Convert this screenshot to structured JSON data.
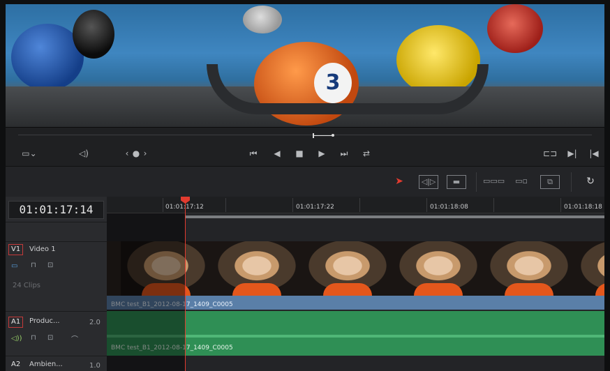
{
  "viewer": {
    "ball_number": "3"
  },
  "transport": {
    "icons": [
      "monitor-icon",
      "chevron-down-icon",
      "speaker-icon",
      "prev-edit-icon",
      "dot-icon",
      "next-edit-icon",
      "skip-back-icon",
      "step-back-icon",
      "stop-icon",
      "play-icon",
      "skip-forward-icon",
      "loop-icon",
      "loop-region-icon",
      "go-in-icon",
      "go-out-icon"
    ]
  },
  "toolbar": {
    "tools": [
      "selection-tool-icon",
      "trim-tool-icon",
      "blade-tool-icon",
      "insert-clip-icon",
      "overwrite-clip-icon",
      "replace-clip-icon",
      "snapping-icon"
    ],
    "accent": "#e23b2f"
  },
  "timeline": {
    "timecode": "01:01:17:14",
    "ruler": [
      {
        "label": "01:01:17:12"
      },
      {
        "label": "01:01:17:22"
      },
      {
        "label": "01:01:18:08"
      },
      {
        "label": "01:01:18:18"
      }
    ],
    "tracks": {
      "v1": {
        "badge": "V1",
        "name": "Video 1",
        "clips": "24 Clips",
        "clip_label": "BMC test_B1_2012-08-17_1409_C0005",
        "color": "#5a7fa8"
      },
      "a1": {
        "badge": "A1",
        "name": "Produc...",
        "level": "2.0",
        "clip_label": "BMC test_B1_2012-08-17_1409_C0005",
        "color": "#2f8f55"
      },
      "a2": {
        "badge": "A2",
        "name": "Ambien...",
        "level": "1.0"
      }
    }
  }
}
